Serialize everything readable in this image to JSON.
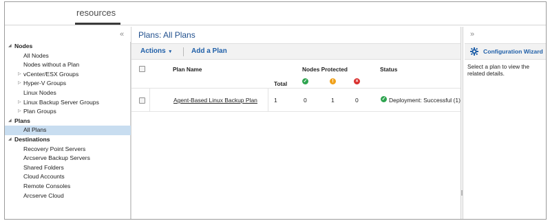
{
  "top_tabs": {
    "active": "resources"
  },
  "nav": {
    "collapse_icon": "«",
    "tree": [
      {
        "label": "Nodes",
        "kind": "section",
        "expanded": true
      },
      {
        "label": "All Nodes",
        "kind": "leaf"
      },
      {
        "label": "Nodes without a Plan",
        "kind": "leaf"
      },
      {
        "label": "vCenter/ESX Groups",
        "kind": "group"
      },
      {
        "label": "Hyper-V Groups",
        "kind": "group"
      },
      {
        "label": "Linux Nodes",
        "kind": "leaf"
      },
      {
        "label": "Linux Backup Server Groups",
        "kind": "group"
      },
      {
        "label": "Plan Groups",
        "kind": "group"
      },
      {
        "label": "Plans",
        "kind": "section",
        "expanded": true
      },
      {
        "label": "All Plans",
        "kind": "leaf",
        "selected": true
      },
      {
        "label": "Destinations",
        "kind": "section",
        "expanded": true
      },
      {
        "label": "Recovery Point Servers",
        "kind": "leaf"
      },
      {
        "label": "Arcserve Backup Servers",
        "kind": "leaf"
      },
      {
        "label": "Shared Folders",
        "kind": "leaf"
      },
      {
        "label": "Cloud Accounts",
        "kind": "leaf"
      },
      {
        "label": "Remote Consoles",
        "kind": "leaf"
      },
      {
        "label": "Arcserve Cloud",
        "kind": "leaf"
      }
    ]
  },
  "center": {
    "title": "Plans: All Plans",
    "toolbar": {
      "actions_label": "Actions",
      "actions_caret": "▾",
      "add_label": "Add a Plan"
    },
    "columns": {
      "plan_name": "Plan Name",
      "nodes_protected": "Nodes Protected",
      "total": "Total",
      "status": "Status"
    },
    "rows": [
      {
        "plan_name": "Agent-Based Linux Backup Plan",
        "total": "1",
        "successful": "0",
        "warning": "1",
        "failed": "0",
        "status": "Deployment: Successful (1)"
      }
    ]
  },
  "right": {
    "expand_icon": "»",
    "wizard_label": "Configuration Wizard",
    "hint": "Select a plan to view the related details."
  },
  "colors": {
    "link_blue": "#1f5fa8",
    "title_blue": "#1f4e8c",
    "selected_bg": "#c8ddf0",
    "ok": "#2ea44f",
    "warn": "#f0a11a",
    "err": "#d9302e"
  },
  "icons": [
    "collapse-left-icon",
    "expand-right-icon",
    "gear-icon",
    "check-circle-icon",
    "warning-circle-icon",
    "error-circle-icon",
    "caret-down-icon",
    "tree-arrow-icon"
  ]
}
